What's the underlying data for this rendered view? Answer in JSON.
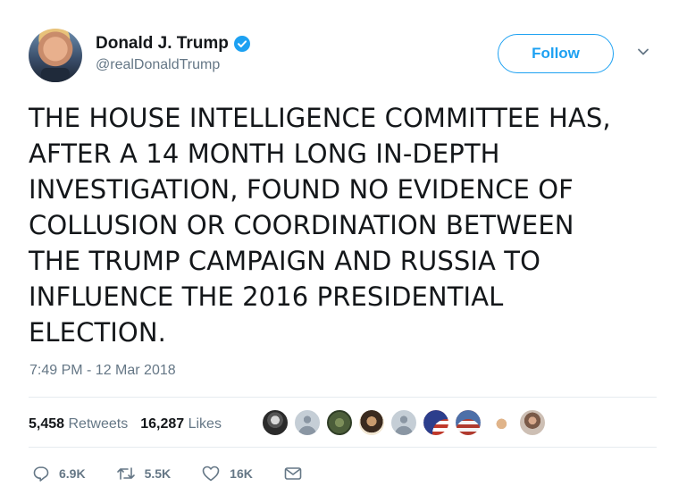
{
  "author": {
    "display_name": "Donald J. Trump",
    "handle": "@realDonaldTrump",
    "verified": true
  },
  "follow_label": "Follow",
  "tweet": {
    "lines": [
      "THE HOUSE INTELLIGENCE COMMITTEE HAS,",
      "AFTER A 14 MONTH LONG IN-DEPTH",
      "INVESTIGATION, FOUND NO EVIDENCE OF",
      "COLLUSION OR COORDINATION BETWEEN",
      "THE TRUMP CAMPAIGN AND RUSSIA TO",
      "INFLUENCE THE 2016 PRESIDENTIAL",
      "ELECTION."
    ],
    "timestamp": "7:49 PM - 12 Mar 2018"
  },
  "stats": {
    "retweets_count": "5,458",
    "retweets_label": "Retweets",
    "likes_count": "16,287",
    "likes_label": "Likes"
  },
  "actions": {
    "reply_count": "6.9K",
    "retweet_count": "5.5K",
    "like_count": "16K"
  },
  "colors": {
    "accent": "#1da1f2",
    "text": "#14171a",
    "muted": "#657786"
  }
}
